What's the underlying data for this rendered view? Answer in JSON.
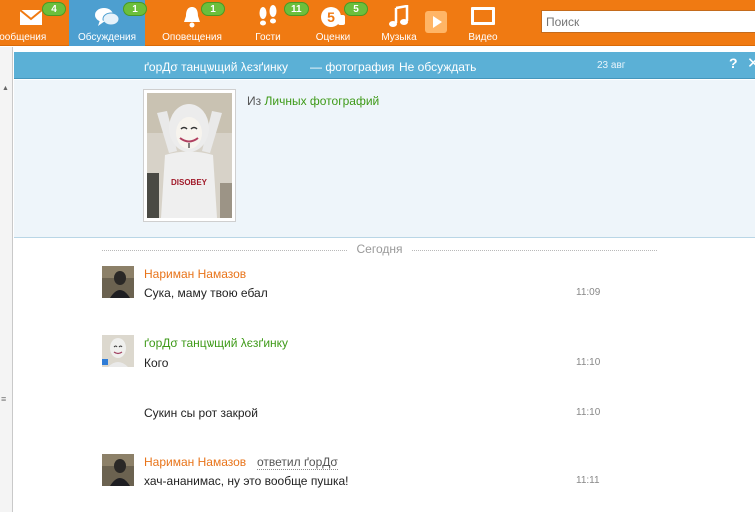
{
  "toolbar": {
    "items": [
      {
        "label": "Сообщения",
        "badge": "4",
        "icon": "envelope-icon",
        "active": false
      },
      {
        "label": "Обсуждения",
        "badge": "1",
        "icon": "discussion-bubbles-icon",
        "active": true
      },
      {
        "label": "Оповещения",
        "badge": "1",
        "icon": "bell-icon",
        "active": false
      },
      {
        "label": "Гости",
        "badge": "11",
        "icon": "footprints-icon",
        "active": false
      },
      {
        "label": "Оценки",
        "badge": "5",
        "icon": "rating-five-icon",
        "active": false
      },
      {
        "label": "Музыка",
        "badge": "",
        "icon": "music-note-icon",
        "active": false
      },
      {
        "label": "Видео",
        "badge": "",
        "icon": "tv-screen-icon",
        "active": false
      }
    ],
    "search_placeholder": "Поиск",
    "colors": {
      "bar": "#f07a12",
      "active": "#4d9fd0",
      "badge": "#6cbf3c"
    }
  },
  "topic": {
    "author": "ґорДσ танцѡщий λєзґинку",
    "dash_text": "— фотография",
    "unfollow_link": "Не обсуждать",
    "date": "23 авг",
    "help": "?",
    "close": "✕",
    "bar_color": "#5bb0d6"
  },
  "photo": {
    "from_prefix": "Из",
    "album_link": "Личных фотографий",
    "shirt_text": "DISOBEY"
  },
  "divider": {
    "label": "Сегодня"
  },
  "messages": [
    {
      "author": "Нариман Намазов",
      "text": "Сука, маму твою ебал",
      "time": "11:09",
      "reply_to": ""
    },
    {
      "author": "ґорДσ танцѡщий λєзґинку",
      "text": "Кого",
      "time": "11:10",
      "reply_to": ""
    },
    {
      "author": "",
      "text": "Сукин сы рот закрой",
      "time": "11:10",
      "reply_to": ""
    },
    {
      "author": "Нариман Намазов",
      "text": "хач-ананимас, ну это вообще пушка!",
      "time": "11:11",
      "reply_to": "ответил ґорДσ"
    }
  ]
}
